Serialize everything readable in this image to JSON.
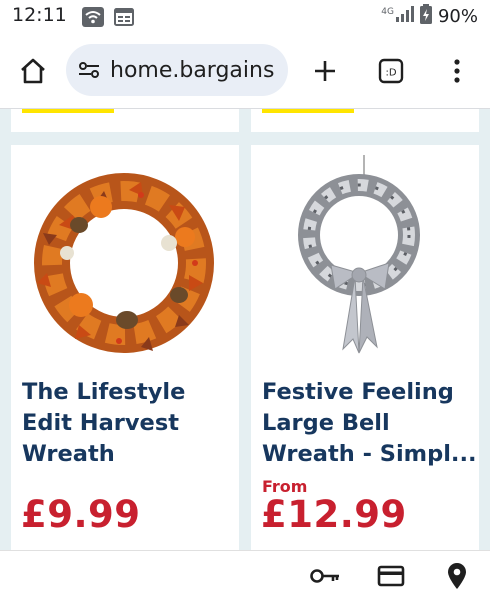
{
  "status": {
    "time": "12:11",
    "network": "4G",
    "battery": "90%"
  },
  "browser": {
    "url": "home.bargains"
  },
  "products": [
    {
      "title_lines": [
        "The Lifestyle",
        "Edit Harvest",
        "Wreath"
      ],
      "price": "£9.99",
      "price_prefix": ""
    },
    {
      "title_lines": [
        "Festive Feeling",
        "Large Bell",
        "Wreath - Simpl..."
      ],
      "price": "£12.99",
      "price_prefix": "From"
    }
  ],
  "colors": {
    "title": "#17375e",
    "price": "#c8202f",
    "badge": "#ffe500",
    "background": "#e5eff2"
  },
  "icons": [
    "wifi-icon",
    "calendar-icon",
    "signal-icon",
    "battery-icon",
    "home-icon",
    "site-settings-icon",
    "new-tab-icon",
    "tab-switcher-icon",
    "menu-icon",
    "key-icon",
    "card-icon",
    "location-icon"
  ]
}
